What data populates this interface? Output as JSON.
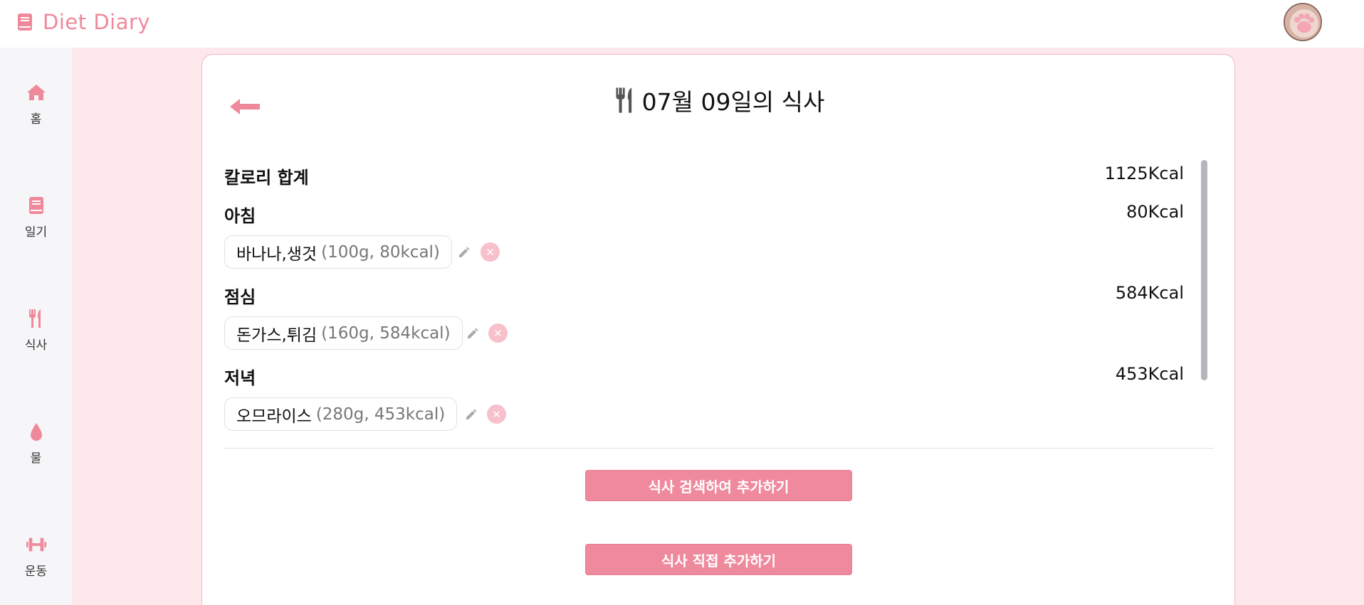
{
  "app": {
    "title": "Diet Diary",
    "accent_color": "#f0889b",
    "brand_icon": "book-icon",
    "avatar_icon": "paw-icon"
  },
  "sidebar": {
    "items": [
      {
        "label": "홈",
        "icon": "home-icon"
      },
      {
        "label": "일기",
        "icon": "book-icon"
      },
      {
        "label": "식사",
        "icon": "utensils-icon"
      },
      {
        "label": "물",
        "icon": "water-drop-icon"
      },
      {
        "label": "운동",
        "icon": "dumbbell-icon"
      }
    ]
  },
  "page": {
    "title": "07월 09일의 식사",
    "title_icon": "utensils-icon",
    "back_icon": "arrow-left-icon"
  },
  "summary": {
    "total_label": "칼로리 합계",
    "total_value": "1125Kcal"
  },
  "meals": [
    {
      "label": "아침",
      "kcal": "80Kcal",
      "item": {
        "name": "바나나,생것",
        "detail": "(100g, 80kcal)"
      }
    },
    {
      "label": "점심",
      "kcal": "584Kcal",
      "item": {
        "name": "돈가스,튀김",
        "detail": "(160g, 584kcal)"
      }
    },
    {
      "label": "저녁",
      "kcal": "453Kcal",
      "item": {
        "name": "오므라이스",
        "detail": "(280g, 453kcal)"
      }
    }
  ],
  "actions": {
    "search_add": "식사 검색하여 추가하기",
    "direct_add": "식사 직접 추가하기"
  }
}
